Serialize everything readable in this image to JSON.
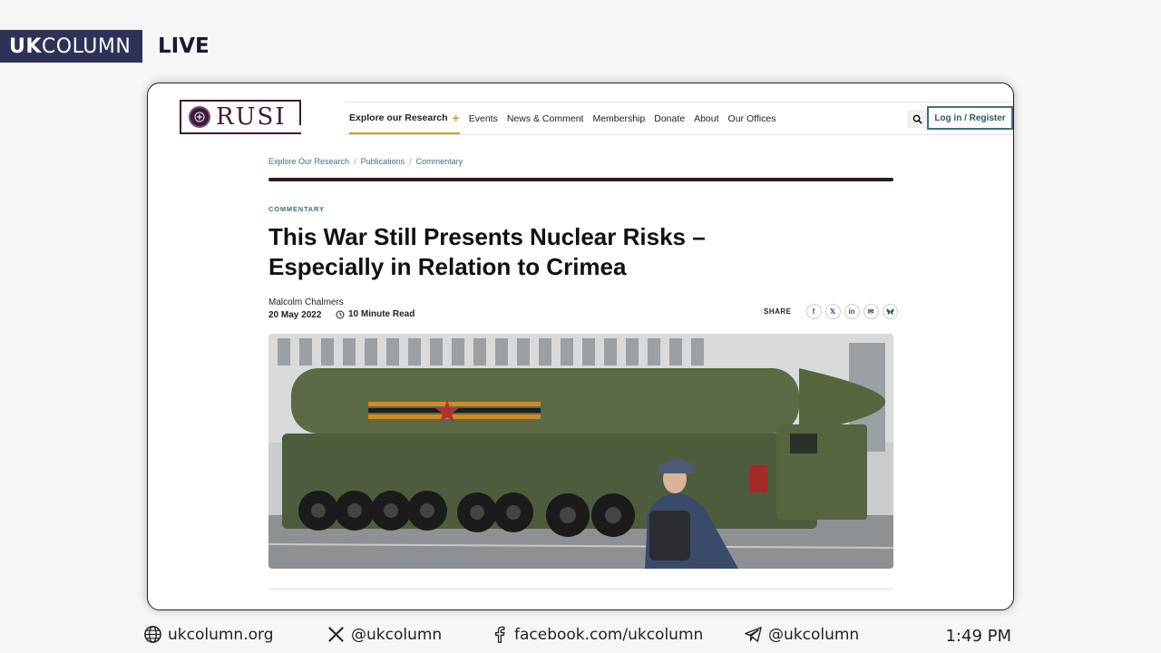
{
  "overlay": {
    "logo_uk": "UK",
    "logo_column": "COLUMN",
    "live": "LIVE"
  },
  "site": {
    "logo_text": "RUSI",
    "nav": [
      {
        "label": "Explore our Research",
        "active": true
      },
      {
        "label": "Events"
      },
      {
        "label": "News & Comment"
      },
      {
        "label": "Membership"
      },
      {
        "label": "Donate"
      },
      {
        "label": "About"
      },
      {
        "label": "Our Offices"
      }
    ],
    "login_label": "Log in / Register"
  },
  "breadcrumb": [
    "Explore Our Research",
    "Publications",
    "Commentary"
  ],
  "article": {
    "category": "COMMENTARY",
    "title_line1": "This War Still Presents Nuclear Risks –",
    "title_line2": "Especially in Relation to Crimea",
    "author": "Malcolm Chalmers",
    "date": "20 May 2022",
    "read_time": "10 Minute Read",
    "share_label": "SHARE"
  },
  "share_icons": [
    "facebook-icon",
    "x-icon",
    "linkedin-icon",
    "email-icon",
    "bluesky-icon"
  ],
  "footer": {
    "website": "ukcolumn.org",
    "x_handle": "@ukcolumn",
    "facebook": "facebook.com/ukcolumn",
    "telegram": "@ukcolumn",
    "time": "1:49 PM"
  },
  "colors": {
    "ukc_navy": "#2e3257",
    "rusi_plum": "#3b1b3a",
    "rusi_teal": "#3f6f7c",
    "accent_gold": "#c9a227"
  }
}
